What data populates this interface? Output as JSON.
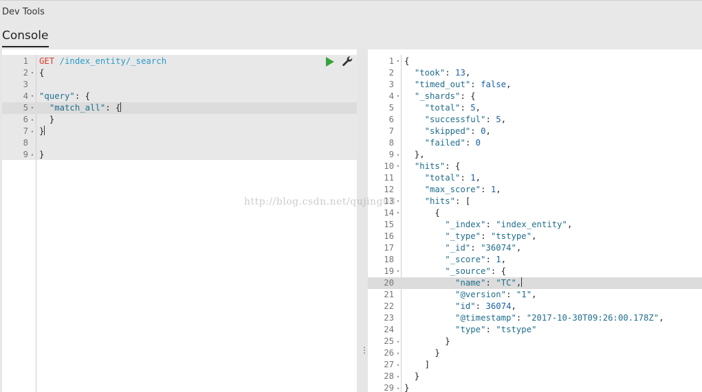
{
  "app": {
    "title": "Dev Tools",
    "tab": "Console"
  },
  "request": {
    "lines": [
      {
        "n": "1",
        "fold": "",
        "parts": [
          [
            "m",
            "GET"
          ],
          [
            "p",
            " "
          ],
          [
            "u",
            "/index_entity/_search"
          ]
        ]
      },
      {
        "n": "2",
        "fold": "▾",
        "parts": [
          [
            "p",
            "{"
          ]
        ]
      },
      {
        "n": "3",
        "fold": "",
        "parts": []
      },
      {
        "n": "4",
        "fold": "▾",
        "parts": [
          [
            "k",
            "\"query\""
          ],
          [
            "p",
            ": {"
          ]
        ]
      },
      {
        "n": "5",
        "fold": "▾",
        "parts": [
          [
            "p",
            "  "
          ],
          [
            "k",
            "\"match_all\""
          ],
          [
            "p",
            ": {"
          ]
        ],
        "active": true,
        "cursor": true
      },
      {
        "n": "6",
        "fold": "▴",
        "parts": [
          [
            "p",
            "  }"
          ]
        ]
      },
      {
        "n": "7",
        "fold": "▴",
        "parts": [
          [
            "p",
            "}"
          ]
        ],
        "cursor": true
      },
      {
        "n": "8",
        "fold": "",
        "parts": []
      },
      {
        "n": "9",
        "fold": "▴",
        "parts": [
          [
            "p",
            "}"
          ]
        ]
      }
    ]
  },
  "response": {
    "lines": [
      {
        "n": "1",
        "fold": "▾",
        "parts": [
          [
            "p",
            "{"
          ]
        ]
      },
      {
        "n": "2",
        "fold": "",
        "parts": [
          [
            "p",
            "  "
          ],
          [
            "k",
            "\"took\""
          ],
          [
            "p",
            ": "
          ],
          [
            "n",
            "13"
          ],
          [
            "p",
            ","
          ]
        ]
      },
      {
        "n": "3",
        "fold": "",
        "parts": [
          [
            "p",
            "  "
          ],
          [
            "k",
            "\"timed_out\""
          ],
          [
            "p",
            ": "
          ],
          [
            "b",
            "false"
          ],
          [
            "p",
            ","
          ]
        ]
      },
      {
        "n": "4",
        "fold": "▾",
        "parts": [
          [
            "p",
            "  "
          ],
          [
            "k",
            "\"_shards\""
          ],
          [
            "p",
            ": {"
          ]
        ]
      },
      {
        "n": "5",
        "fold": "",
        "parts": [
          [
            "p",
            "    "
          ],
          [
            "k",
            "\"total\""
          ],
          [
            "p",
            ": "
          ],
          [
            "n",
            "5"
          ],
          [
            "p",
            ","
          ]
        ]
      },
      {
        "n": "6",
        "fold": "",
        "parts": [
          [
            "p",
            "    "
          ],
          [
            "k",
            "\"successful\""
          ],
          [
            "p",
            ": "
          ],
          [
            "n",
            "5"
          ],
          [
            "p",
            ","
          ]
        ]
      },
      {
        "n": "7",
        "fold": "",
        "parts": [
          [
            "p",
            "    "
          ],
          [
            "k",
            "\"skipped\""
          ],
          [
            "p",
            ": "
          ],
          [
            "n",
            "0"
          ],
          [
            "p",
            ","
          ]
        ]
      },
      {
        "n": "8",
        "fold": "",
        "parts": [
          [
            "p",
            "    "
          ],
          [
            "k",
            "\"failed\""
          ],
          [
            "p",
            ": "
          ],
          [
            "n",
            "0"
          ]
        ]
      },
      {
        "n": "9",
        "fold": "▴",
        "parts": [
          [
            "p",
            "  },"
          ]
        ]
      },
      {
        "n": "10",
        "fold": "▾",
        "parts": [
          [
            "p",
            "  "
          ],
          [
            "k",
            "\"hits\""
          ],
          [
            "p",
            ": {"
          ]
        ]
      },
      {
        "n": "11",
        "fold": "",
        "parts": [
          [
            "p",
            "    "
          ],
          [
            "k",
            "\"total\""
          ],
          [
            "p",
            ": "
          ],
          [
            "n",
            "1"
          ],
          [
            "p",
            ","
          ]
        ]
      },
      {
        "n": "12",
        "fold": "",
        "parts": [
          [
            "p",
            "    "
          ],
          [
            "k",
            "\"max_score\""
          ],
          [
            "p",
            ": "
          ],
          [
            "n",
            "1"
          ],
          [
            "p",
            ","
          ]
        ]
      },
      {
        "n": "13",
        "fold": "▾",
        "parts": [
          [
            "p",
            "    "
          ],
          [
            "k",
            "\"hits\""
          ],
          [
            "p",
            ": ["
          ]
        ]
      },
      {
        "n": "14",
        "fold": "▾",
        "parts": [
          [
            "p",
            "      {"
          ]
        ]
      },
      {
        "n": "15",
        "fold": "",
        "parts": [
          [
            "p",
            "        "
          ],
          [
            "k",
            "\"_index\""
          ],
          [
            "p",
            ": "
          ],
          [
            "s",
            "\"index_entity\""
          ],
          [
            "p",
            ","
          ]
        ]
      },
      {
        "n": "16",
        "fold": "",
        "parts": [
          [
            "p",
            "        "
          ],
          [
            "k",
            "\"_type\""
          ],
          [
            "p",
            ": "
          ],
          [
            "s",
            "\"tstype\""
          ],
          [
            "p",
            ","
          ]
        ]
      },
      {
        "n": "17",
        "fold": "",
        "parts": [
          [
            "p",
            "        "
          ],
          [
            "k",
            "\"_id\""
          ],
          [
            "p",
            ": "
          ],
          [
            "s",
            "\"36074\""
          ],
          [
            "p",
            ","
          ]
        ]
      },
      {
        "n": "18",
        "fold": "",
        "parts": [
          [
            "p",
            "        "
          ],
          [
            "k",
            "\"_score\""
          ],
          [
            "p",
            ": "
          ],
          [
            "n",
            "1"
          ],
          [
            "p",
            ","
          ]
        ]
      },
      {
        "n": "19",
        "fold": "▾",
        "parts": [
          [
            "p",
            "        "
          ],
          [
            "k",
            "\"_source\""
          ],
          [
            "p",
            ": {"
          ]
        ]
      },
      {
        "n": "20",
        "fold": "",
        "parts": [
          [
            "p",
            "          "
          ],
          [
            "k",
            "\"name\""
          ],
          [
            "p",
            ": "
          ],
          [
            "s",
            "\"TC\""
          ],
          [
            "p",
            ","
          ]
        ],
        "active": true,
        "cursor": true
      },
      {
        "n": "21",
        "fold": "",
        "parts": [
          [
            "p",
            "          "
          ],
          [
            "k",
            "\"@version\""
          ],
          [
            "p",
            ": "
          ],
          [
            "s",
            "\"1\""
          ],
          [
            "p",
            ","
          ]
        ]
      },
      {
        "n": "22",
        "fold": "",
        "parts": [
          [
            "p",
            "          "
          ],
          [
            "k",
            "\"id\""
          ],
          [
            "p",
            ": "
          ],
          [
            "n",
            "36074"
          ],
          [
            "p",
            ","
          ]
        ]
      },
      {
        "n": "23",
        "fold": "",
        "parts": [
          [
            "p",
            "          "
          ],
          [
            "k",
            "\"@timestamp\""
          ],
          [
            "p",
            ": "
          ],
          [
            "s",
            "\"2017-10-30T09:26:00.178Z\""
          ],
          [
            "p",
            ","
          ]
        ]
      },
      {
        "n": "24",
        "fold": "",
        "parts": [
          [
            "p",
            "          "
          ],
          [
            "k",
            "\"type\""
          ],
          [
            "p",
            ": "
          ],
          [
            "s",
            "\"tstype\""
          ]
        ]
      },
      {
        "n": "25",
        "fold": "▴",
        "parts": [
          [
            "p",
            "        }"
          ]
        ]
      },
      {
        "n": "26",
        "fold": "▴",
        "parts": [
          [
            "p",
            "      }"
          ]
        ]
      },
      {
        "n": "27",
        "fold": "▴",
        "parts": [
          [
            "p",
            "    ]"
          ]
        ]
      },
      {
        "n": "28",
        "fold": "▴",
        "parts": [
          [
            "p",
            "  }"
          ]
        ]
      },
      {
        "n": "29",
        "fold": "▴",
        "parts": [
          [
            "p",
            "}"
          ]
        ]
      }
    ]
  },
  "icons": {
    "run": "play-icon",
    "settings": "wrench-icon",
    "resize": "vertical-ellipsis-icon"
  },
  "colors": {
    "run": "#37a33c",
    "method": "#e0372a",
    "url": "#2a9bc8",
    "key": "#1f6d8c",
    "number": "#1a5fa5"
  },
  "watermark": "http://blog.csdn.net/qujing08"
}
